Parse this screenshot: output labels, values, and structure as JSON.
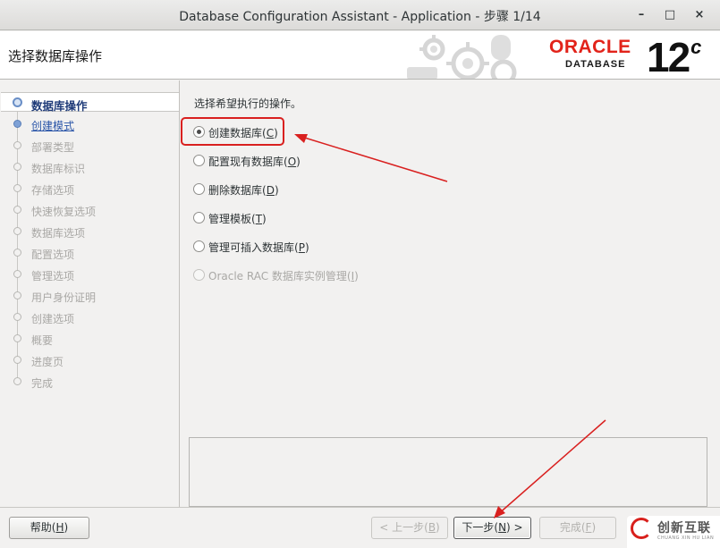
{
  "window": {
    "title": "Database Configuration Assistant - Application - 步骤 1/14",
    "minimize": "–",
    "maximize": "□",
    "close": "×"
  },
  "header": {
    "step_title": "选择数据库操作",
    "brand": "ORACLE",
    "brand_sub": "DATABASE",
    "version": "12",
    "version_suffix": "c"
  },
  "nav": {
    "items": [
      {
        "label": "数据库操作",
        "state": "current"
      },
      {
        "label": "创建模式",
        "state": "link"
      },
      {
        "label": "部署类型",
        "state": "disabled"
      },
      {
        "label": "数据库标识",
        "state": "disabled"
      },
      {
        "label": "存储选项",
        "state": "disabled"
      },
      {
        "label": "快速恢复选项",
        "state": "disabled"
      },
      {
        "label": "数据库选项",
        "state": "disabled"
      },
      {
        "label": "配置选项",
        "state": "disabled"
      },
      {
        "label": "管理选项",
        "state": "disabled"
      },
      {
        "label": "用户身份证明",
        "state": "disabled"
      },
      {
        "label": "创建选项",
        "state": "disabled"
      },
      {
        "label": "概要",
        "state": "disabled"
      },
      {
        "label": "进度页",
        "state": "disabled"
      },
      {
        "label": "完成",
        "state": "disabled"
      }
    ]
  },
  "main": {
    "prompt": "选择希望执行的操作。",
    "options": [
      {
        "label": "创建数据库(",
        "mnemonic": "C",
        "suffix": ")",
        "checked": true,
        "enabled": true
      },
      {
        "label": "配置现有数据库(",
        "mnemonic": "O",
        "suffix": ")",
        "checked": false,
        "enabled": true
      },
      {
        "label": "删除数据库(",
        "mnemonic": "D",
        "suffix": ")",
        "checked": false,
        "enabled": true
      },
      {
        "label": "管理模板(",
        "mnemonic": "T",
        "suffix": ")",
        "checked": false,
        "enabled": true
      },
      {
        "label": "管理可插入数据库(",
        "mnemonic": "P",
        "suffix": ")",
        "checked": false,
        "enabled": true
      },
      {
        "label": "Oracle RAC 数据库实例管理(",
        "mnemonic": "I",
        "suffix": ")",
        "checked": false,
        "enabled": false
      }
    ]
  },
  "footer": {
    "help": {
      "label": "帮助(",
      "mnemonic": "H",
      "suffix": ")"
    },
    "back": {
      "label": "< 上一步(",
      "mnemonic": "B",
      "suffix": ")"
    },
    "next": {
      "label": "下一步(",
      "mnemonic": "N",
      "suffix": ") >"
    },
    "finish": {
      "label": "完成(",
      "mnemonic": "F",
      "suffix": ")"
    }
  },
  "watermark": {
    "text": "创新互联",
    "sub": "CHUANG XIN HU LIAN"
  },
  "colors": {
    "annotation_red": "#d9201f",
    "oracle_red": "#e2231a",
    "nav_current": "#1e3a78",
    "nav_link": "#2a55a8"
  }
}
